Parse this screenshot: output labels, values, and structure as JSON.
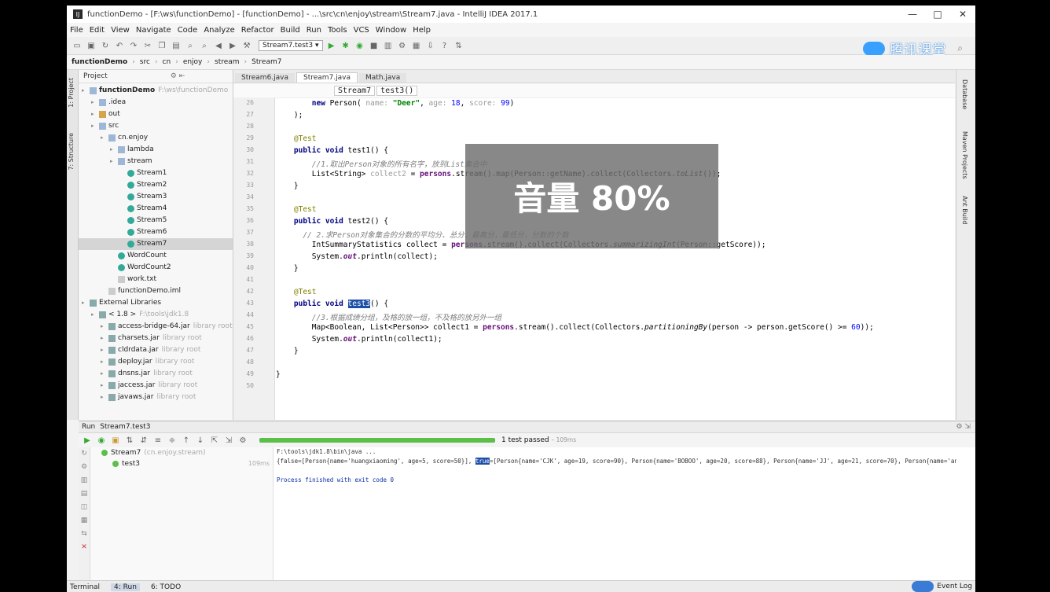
{
  "window": {
    "title": "functionDemo - [F:\\ws\\functionDemo] - [functionDemo] - ...\\src\\cn\\enjoy\\stream\\Stream7.java - IntelliJ IDEA 2017.1",
    "controls": [
      "—",
      "□",
      "✕"
    ]
  },
  "menu": [
    "File",
    "Edit",
    "View",
    "Navigate",
    "Code",
    "Analyze",
    "Refactor",
    "Build",
    "Run",
    "Tools",
    "VCS",
    "Window",
    "Help"
  ],
  "toolbar": {
    "run_config": "Stream7.test3 ▾"
  },
  "brand": {
    "text": "腾讯课堂"
  },
  "breadcrumb": [
    "functionDemo",
    "src",
    "cn",
    "enjoy",
    "stream",
    "Stream7"
  ],
  "project": {
    "header": "Project",
    "tree": [
      {
        "label": "functionDemo",
        "hint": "F:\\ws\\functionDemo",
        "indent": 0,
        "type": "folder",
        "bold": true
      },
      {
        "label": ".idea",
        "indent": 1,
        "type": "folder"
      },
      {
        "label": "out",
        "indent": 1,
        "type": "folder o"
      },
      {
        "label": "src",
        "indent": 1,
        "type": "folder"
      },
      {
        "label": "cn.enjoy",
        "indent": 2,
        "type": "folder"
      },
      {
        "label": "lambda",
        "indent": 3,
        "type": "folder"
      },
      {
        "label": "stream",
        "indent": 3,
        "type": "folder"
      },
      {
        "label": "Stream1",
        "indent": 4,
        "type": "java"
      },
      {
        "label": "Stream2",
        "indent": 4,
        "type": "java"
      },
      {
        "label": "Stream3",
        "indent": 4,
        "type": "java"
      },
      {
        "label": "Stream4",
        "indent": 4,
        "type": "java"
      },
      {
        "label": "Stream5",
        "indent": 4,
        "type": "java"
      },
      {
        "label": "Stream6",
        "indent": 4,
        "type": "java"
      },
      {
        "label": "Stream7",
        "indent": 4,
        "type": "java",
        "selected": true
      },
      {
        "label": "WordCount",
        "indent": 3,
        "type": "java"
      },
      {
        "label": "WordCount2",
        "indent": 3,
        "type": "java"
      },
      {
        "label": "work.txt",
        "indent": 3,
        "type": "file"
      },
      {
        "label": "functionDemo.iml",
        "indent": 2,
        "type": "file"
      },
      {
        "label": "External Libraries",
        "indent": 0,
        "type": "lib"
      },
      {
        "label": "< 1.8 >",
        "hint": "F:\\tools\\jdk1.8",
        "indent": 1,
        "type": "lib"
      },
      {
        "label": "access-bridge-64.jar",
        "hint": "library root",
        "indent": 2,
        "type": "lib"
      },
      {
        "label": "charsets.jar",
        "hint": "library root",
        "indent": 2,
        "type": "lib"
      },
      {
        "label": "cldrdata.jar",
        "hint": "library root",
        "indent": 2,
        "type": "lib"
      },
      {
        "label": "deploy.jar",
        "hint": "library root",
        "indent": 2,
        "type": "lib"
      },
      {
        "label": "dnsns.jar",
        "hint": "library root",
        "indent": 2,
        "type": "lib"
      },
      {
        "label": "jaccess.jar",
        "hint": "library root",
        "indent": 2,
        "type": "lib"
      },
      {
        "label": "javaws.jar",
        "hint": "library root",
        "indent": 2,
        "type": "lib"
      }
    ]
  },
  "editor": {
    "tabs": [
      "Stream6.java",
      "Stream7.java",
      "Math.java"
    ],
    "active_tab": 1,
    "crumbs": [
      "Stream7",
      "test3()"
    ],
    "line_numbers": [
      "26",
      "27",
      "28",
      "29",
      "30",
      "31",
      "32",
      "33",
      "34",
      "35",
      "36",
      "37",
      "38",
      "39",
      "40",
      "41",
      "42",
      "43",
      "44",
      "45",
      "46",
      "47",
      "48",
      "49",
      "50"
    ]
  },
  "overlay": {
    "text": "音量 80%"
  },
  "right_tools": [
    "Database",
    "Maven Projects",
    "Ant Build"
  ],
  "left_tools": [
    "1: Project",
    "7: Structure",
    "2: Favorites"
  ],
  "run": {
    "header": "Run",
    "config": "Stream7.test3",
    "status": "1 test passed",
    "duration": "– 109ms",
    "tree": [
      {
        "label": "Stream7",
        "hint": "(cn.enjoy.stream)",
        "time": "109ms"
      },
      {
        "label": "test3",
        "time": "109ms"
      }
    ],
    "console": [
      "F:\\tools\\jdk1.8\\bin\\java ...",
      "{false=[Person{name='huangxiaoming', age=5, score=50}], ",
      "",
      "Process finished with exit code 0"
    ],
    "console_line2_sel": "true",
    "console_line2_rest": "=[Person{name='CJK', age=19, score=90}, Person{name='BOBOO', age=20, score=88}, Person{name='JJ', age=21, score=70}, Person{name='anglababb"
  },
  "status": {
    "terminal": "Terminal",
    "run": "4: Run",
    "todo": "6: TODO",
    "event_log": "Event Log"
  }
}
